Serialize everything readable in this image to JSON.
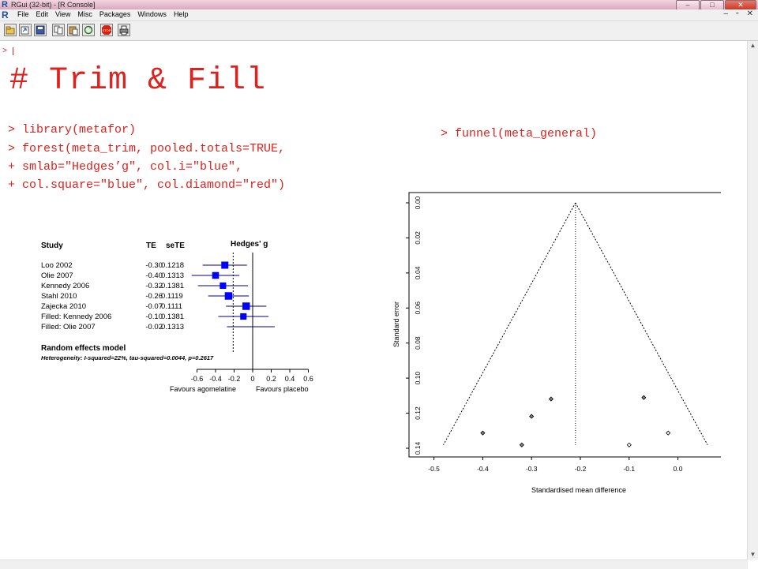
{
  "window": {
    "title": "RGui (32-bit) - [R Console]",
    "logo": "R",
    "controls": [
      "–",
      "□",
      "✕"
    ]
  },
  "menubar": {
    "items": [
      "File",
      "Edit",
      "View",
      "Misc",
      "Packages",
      "Windows",
      "Help"
    ],
    "mdi_controls": [
      "–",
      "▫",
      "✕"
    ]
  },
  "toolbar": {
    "buttons": [
      "open-script-icon",
      "load-workspace-icon",
      "save-workspace-icon",
      "copy-icon",
      "paste-icon",
      "copy-paste-icon",
      "stop-icon",
      "print-icon"
    ]
  },
  "console": {
    "prompt_line": ">",
    "comment": "# Trim & Fill",
    "commands_left": [
      "> library(metafor)",
      "> forest(meta_trim, pooled.totals=TRUE,",
      "+ smlab=\"Hedges’g\", col.i=\"blue\",",
      "+ col.square=\"blue\", col.diamond=\"red\")"
    ],
    "command_right": "> funnel(meta_general)"
  },
  "forest": {
    "col_study": "Study",
    "col_te": "TE",
    "col_sete": "seTE",
    "col_title": "Hedges' g",
    "rows": [
      {
        "study": "Loo 2002",
        "te": "-0.30",
        "sete": "0.1218",
        "te_val": -0.3,
        "weight": 1.0
      },
      {
        "study": "Olie 2007",
        "te": "-0.40",
        "sete": "0.1313",
        "te_val": -0.4,
        "weight": 0.95
      },
      {
        "study": "Kennedy 2006",
        "te": "-0.32",
        "sete": "0.1381",
        "te_val": -0.32,
        "weight": 0.9
      },
      {
        "study": "Stahl 2010",
        "te": "-0.26",
        "sete": "0.1119",
        "te_val": -0.26,
        "weight": 1.05
      },
      {
        "study": "Zajecka 2010",
        "te": "-0.07",
        "sete": "0.1111",
        "te_val": -0.07,
        "weight": 1.05
      },
      {
        "study": "Filled: Kennedy 2006",
        "te": "-0.10",
        "sete": "0.1381",
        "te_val": -0.1,
        "weight": 0.9
      },
      {
        "study": "Filled: Olie 2007",
        "te": "-0.02",
        "sete": "0.1313",
        "te_val": -0.02,
        "weight": 0.0
      }
    ],
    "random_label": "Random effects model",
    "heterogeneity": "Heterogeneity: I-squared=22%, tau-squared=0.0044, p=0.2617",
    "pooled": -0.21,
    "axis_ticks": [
      "-0.6",
      "-0.4",
      "-0.2",
      "0",
      "0.2",
      "0.4",
      "0.6"
    ],
    "favours_left": "Favours agomelatine",
    "favours_right": "Favours placebo",
    "colors": {
      "square": "#0000ff",
      "line": "#000080"
    }
  },
  "chart_data": {
    "type": "scatter",
    "title": "",
    "xlabel": "Standardised mean difference",
    "ylabel": "Standard error",
    "xlim": [
      -0.5,
      0.0
    ],
    "ylim": [
      0.14,
      0.0
    ],
    "x_ticks": [
      "-0.5",
      "-0.4",
      "-0.3",
      "-0.2",
      "-0.1",
      "0.0"
    ],
    "y_ticks": [
      "0.00",
      "0.02",
      "0.04",
      "0.06",
      "0.08",
      "0.10",
      "0.12",
      "0.14"
    ],
    "pooled_estimate": -0.21,
    "points": [
      {
        "x": -0.3,
        "y": 0.1218
      },
      {
        "x": -0.4,
        "y": 0.1313
      },
      {
        "x": -0.32,
        "y": 0.1381
      },
      {
        "x": -0.26,
        "y": 0.1119
      },
      {
        "x": -0.07,
        "y": 0.1111
      },
      {
        "x": -0.1,
        "y": 0.1381
      },
      {
        "x": -0.02,
        "y": 0.1313
      }
    ],
    "grid": false
  }
}
